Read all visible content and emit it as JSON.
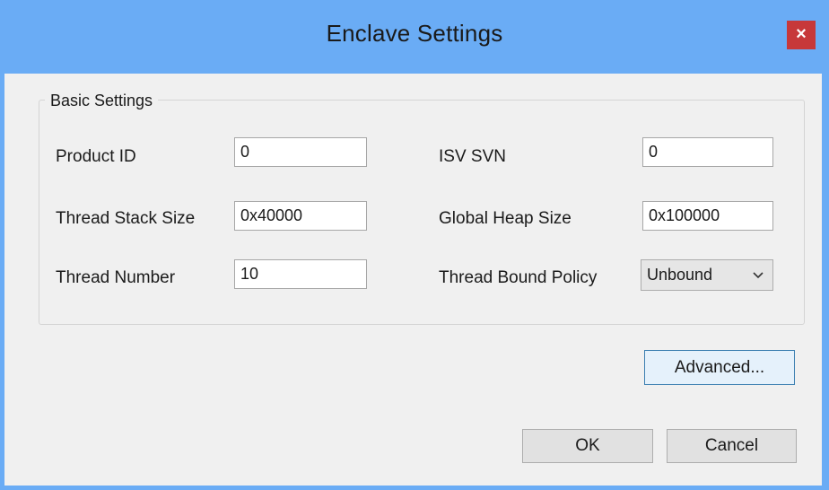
{
  "window": {
    "title": "Enclave Settings",
    "close_glyph": "×"
  },
  "basic_settings": {
    "legend": "Basic Settings",
    "product_id": {
      "label": "Product ID",
      "value": "0"
    },
    "isv_svn": {
      "label": "ISV SVN",
      "value": "0"
    },
    "thread_stack_size": {
      "label": "Thread Stack Size",
      "value": "0x40000"
    },
    "global_heap_size": {
      "label": "Global Heap Size",
      "value": "0x100000"
    },
    "thread_number": {
      "label": "Thread Number",
      "value": "10"
    },
    "thread_bound_policy": {
      "label": "Thread Bound Policy",
      "value": "Unbound"
    }
  },
  "buttons": {
    "advanced": "Advanced...",
    "ok": "OK",
    "cancel": "Cancel"
  },
  "colors": {
    "titlebar": "#6aacf5",
    "close_button": "#c7383a",
    "client_background": "#f0f0f0",
    "focus_border": "#3c7fb1"
  },
  "icons": {
    "close": "close-icon",
    "dropdown": "chevron-down-icon"
  }
}
